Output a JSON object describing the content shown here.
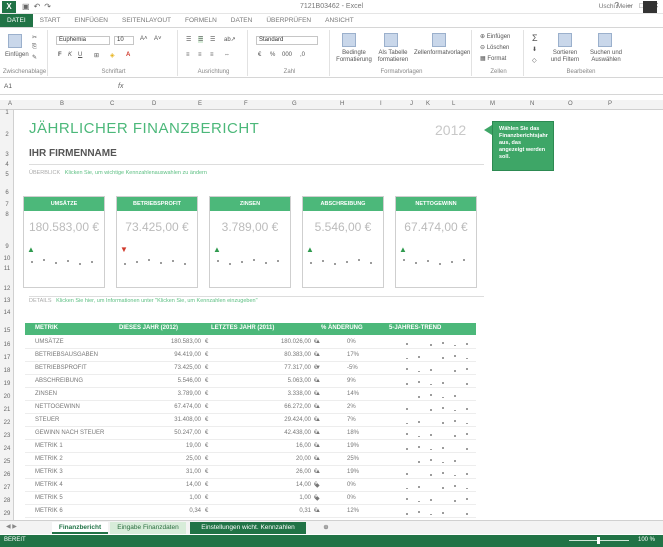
{
  "window": {
    "title": "7121B03462 - Excel",
    "user": "Uschi Meier"
  },
  "ribbon_tabs": [
    "DATEI",
    "START",
    "EINFÜGEN",
    "SEITENLAYOUT",
    "FORMELN",
    "DATEN",
    "ÜBERPRÜFEN",
    "ANSICHT"
  ],
  "ribbon": {
    "paste_label": "Einfügen",
    "clipboard_label": "Zwischenablage",
    "font_label": "Schriftart",
    "font_name": "Euphemia",
    "font_size": "10",
    "alignment_label": "Ausrichtung",
    "number_label": "Zahl",
    "number_format": "Standard",
    "cond_format": "Bedingte Formatierung",
    "as_table": "Als Tabelle formatieren",
    "cell_styles": "Zellenformatvorlagen",
    "styles_label": "Formatvorlagen",
    "insert": "Einfügen",
    "delete": "Löschen",
    "format": "Format",
    "cells_label": "Zellen",
    "sort_filter": "Sortieren und Filtern",
    "find_select": "Suchen und Auswählen",
    "editing_label": "Bearbeiten"
  },
  "formula_bar": {
    "name_box": "A1",
    "fx": "fx"
  },
  "columns": [
    "A",
    "B",
    "C",
    "D",
    "E",
    "F",
    "G",
    "H",
    "I",
    "J",
    "K",
    "L",
    "M",
    "N",
    "O",
    "P"
  ],
  "rows": [
    "1",
    "2",
    "3",
    "4",
    "5",
    "6",
    "7",
    "8",
    "9",
    "10",
    "11",
    "12",
    "13",
    "14",
    "15",
    "16",
    "17",
    "18",
    "19",
    "20",
    "21",
    "22",
    "23",
    "24",
    "25",
    "26",
    "27",
    "28",
    "29"
  ],
  "report": {
    "title": "JÄHRLICHER FINANZBERICHT",
    "year": "2012",
    "company": "IHR FIRMENNAME",
    "hint1_a": "ÜBERBLICK",
    "hint1_b": "Klicken Sie, um wichtige Kennzahlenauswahlen zu ändern",
    "hint2_a": "DETAILS",
    "hint2_b": "Klicken Sie hier, um Informationen unter \"Klicken Sie, um Kennzahlen einzugeben\"",
    "callout": "Wählen Sie das Finanzberichtsjahr aus, das angezeigt werden soll."
  },
  "kpis": [
    {
      "label": "UMSÄTZE",
      "value": "180.583,00 €",
      "trend": "up"
    },
    {
      "label": "BETRIEBSPROFIT",
      "value": "73.425,00 €",
      "trend": "down"
    },
    {
      "label": "ZINSEN",
      "value": "3.789,00 €",
      "trend": "up"
    },
    {
      "label": "ABSCHREIBUNG",
      "value": "5.546,00 €",
      "trend": "up"
    },
    {
      "label": "NETTOGEWINN",
      "value": "67.474,00 €",
      "trend": "up"
    }
  ],
  "table": {
    "headers": [
      "METRIK",
      "DIESES JAHR (2012)",
      "LETZTES JAHR (2011)",
      "% ÄNDERUNG",
      "5-JAHRES-TREND"
    ],
    "currency": "€",
    "rows": [
      {
        "name": "UMSÄTZE",
        "cur": "180.583,00",
        "prev": "180.026,00",
        "trend": "up",
        "pct": "0%"
      },
      {
        "name": "BETRIEBSAUSGABEN",
        "cur": "94.419,00",
        "prev": "80.383,00",
        "trend": "up",
        "pct": "17%"
      },
      {
        "name": "BETRIEBSPROFIT",
        "cur": "73.425,00",
        "prev": "77.317,00",
        "trend": "down",
        "pct": "-5%"
      },
      {
        "name": "ABSCHREIBUNG",
        "cur": "5.546,00",
        "prev": "5.063,00",
        "trend": "up",
        "pct": "9%"
      },
      {
        "name": "ZINSEN",
        "cur": "3.789,00",
        "prev": "3.338,00",
        "trend": "up",
        "pct": "14%"
      },
      {
        "name": "NETTOGEWINN",
        "cur": "67.474,00",
        "prev": "66.272,00",
        "trend": "up",
        "pct": "2%"
      },
      {
        "name": "STEUER",
        "cur": "31.408,00",
        "prev": "29.424,00",
        "trend": "up",
        "pct": "7%"
      },
      {
        "name": "GEWINN NACH STEUER",
        "cur": "50.247,00",
        "prev": "42.438,00",
        "trend": "up",
        "pct": "18%"
      },
      {
        "name": "METRIK 1",
        "cur": "19,00",
        "prev": "16,00",
        "trend": "up",
        "pct": "19%"
      },
      {
        "name": "METRIK 2",
        "cur": "25,00",
        "prev": "20,00",
        "trend": "up",
        "pct": "25%"
      },
      {
        "name": "METRIK 3",
        "cur": "31,00",
        "prev": "26,00",
        "trend": "up",
        "pct": "19%"
      },
      {
        "name": "METRIK 4",
        "cur": "14,00",
        "prev": "14,00",
        "trend": "flat",
        "pct": "0%"
      },
      {
        "name": "METRIK 5",
        "cur": "1,00",
        "prev": "1,00",
        "trend": "flat",
        "pct": "0%"
      },
      {
        "name": "METRIK 6",
        "cur": "0,34",
        "prev": "0,31",
        "trend": "up",
        "pct": "12%"
      }
    ]
  },
  "sheet_tabs": [
    "Finanzbericht",
    "Eingabe Finanzdaten",
    "Einstellungen wicht. Kennzahlen"
  ],
  "status": {
    "left": "BEREIT",
    "zoom": "100 %"
  },
  "colors": {
    "accent": "#4cb87a",
    "excel_green": "#217346",
    "up": "#2f9a4e",
    "down": "#d03a2c",
    "flat": "#e6b21a"
  },
  "icons": {
    "up": "▲",
    "down": "▼",
    "flat": "◆"
  }
}
